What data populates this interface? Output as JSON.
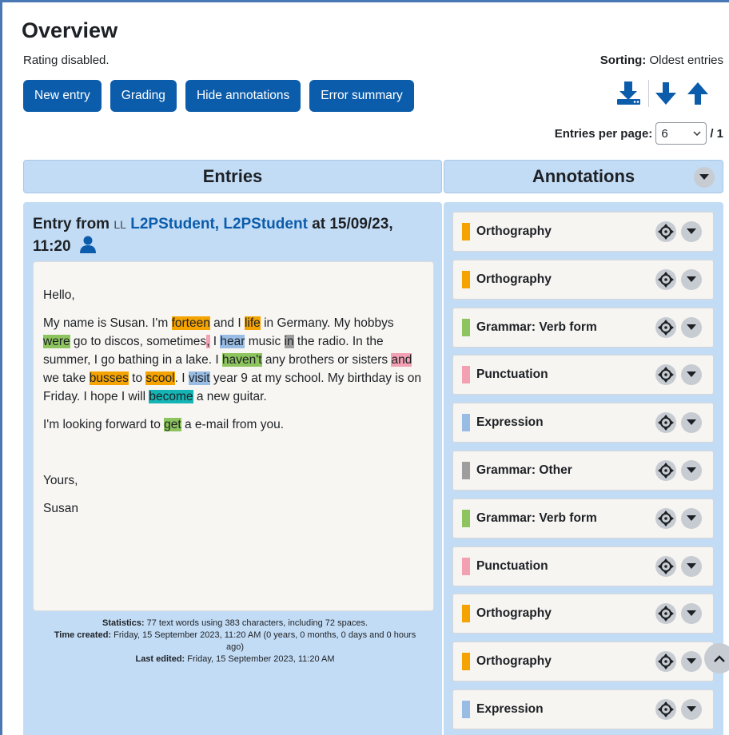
{
  "page": {
    "title": "Overview",
    "rating_status": "Rating disabled.",
    "sorting_label": "Sorting:",
    "sorting_value": "Oldest entries"
  },
  "toolbar": {
    "new_entry": "New entry",
    "grading": "Grading",
    "hide_annotations": "Hide annotations",
    "error_summary": "Error summary"
  },
  "pagination": {
    "entries_per_page_label": "Entries per page:",
    "entries_per_page_value": "6",
    "page_total": "/ 1"
  },
  "headers": {
    "entries": "Entries",
    "annotations": "Annotations"
  },
  "entry": {
    "prefix": "Entry from",
    "initials": "LL",
    "author": "L2PStudent, L2PStudent",
    "at": "at 15/09/23,",
    "time": "11:20",
    "text": {
      "greeting": "Hello,",
      "p1": [
        {
          "t": "My name is Susan. I'm "
        },
        {
          "t": "forteen",
          "c": "o"
        },
        {
          "t": " and I "
        },
        {
          "t": "life",
          "c": "o"
        },
        {
          "t": " in Germany. My hobbys "
        },
        {
          "t": "were",
          "c": "g"
        },
        {
          "t": " go to discos, sometimes"
        },
        {
          "t": ",",
          "c": "p"
        },
        {
          "t": " I "
        },
        {
          "t": "hear",
          "c": "e"
        },
        {
          "t": " music "
        },
        {
          "t": "in",
          "c": "x"
        },
        {
          "t": " the radio. In the summer, I go bathing in a lake. I "
        },
        {
          "t": "haven't",
          "c": "g"
        },
        {
          "t": " any brothers or sisters "
        },
        {
          "t": "and",
          "c": "p"
        },
        {
          "t": " we take "
        },
        {
          "t": "busses",
          "c": "o"
        },
        {
          "t": " to "
        },
        {
          "t": "scool",
          "c": "o"
        },
        {
          "t": ". I "
        },
        {
          "t": "visit",
          "c": "e"
        },
        {
          "t": " year 9 at my school. My birthday is on Friday. I hope I will "
        },
        {
          "t": "become",
          "c": "t"
        },
        {
          "t": " a new guitar."
        }
      ],
      "p2": [
        {
          "t": "I'm looking forward to "
        },
        {
          "t": "get",
          "c": "g"
        },
        {
          "t": " a e-mail from you."
        }
      ],
      "closing": "Yours,",
      "signature": "Susan"
    },
    "stats": {
      "statistics_label": "Statistics:",
      "statistics_value": "77 text words using 383 characters, including 72 spaces.",
      "time_created_label": "Time created:",
      "time_created_value": "Friday, 15 September 2023, 11:20 AM (0 years, 0 months, 0 days and 0 hours ago)",
      "last_edited_label": "Last edited:",
      "last_edited_value": "Friday, 15 September 2023, 11:20 AM"
    }
  },
  "annotations": [
    {
      "label": "Orthography",
      "color": "#f5a300"
    },
    {
      "label": "Orthography",
      "color": "#f5a300"
    },
    {
      "label": "Grammar: Verb form",
      "color": "#8dc45e"
    },
    {
      "label": "Punctuation",
      "color": "#f2a0b2"
    },
    {
      "label": "Expression",
      "color": "#98bce4"
    },
    {
      "label": "Grammar: Other",
      "color": "#9e9e9e"
    },
    {
      "label": "Grammar: Verb form",
      "color": "#8dc45e"
    },
    {
      "label": "Punctuation",
      "color": "#f2a0b2"
    },
    {
      "label": "Orthography",
      "color": "#f5a300"
    },
    {
      "label": "Orthography",
      "color": "#f5a300"
    },
    {
      "label": "Expression",
      "color": "#98bce4"
    }
  ],
  "colors": {
    "primary": "#0b5cab",
    "panel": "#c3dcf5",
    "orthography": "#f5a300",
    "grammar_verb": "#8dc45e",
    "punctuation": "#f2a0b2",
    "expression": "#98bce4",
    "grammar_other": "#9e9e9e",
    "teal": "#16b5b5"
  },
  "icons": [
    "download-icon",
    "arrow-down-icon",
    "arrow-up-icon",
    "chevron-down-icon",
    "crosshair-move-icon",
    "user-icon",
    "chevron-up-icon"
  ]
}
